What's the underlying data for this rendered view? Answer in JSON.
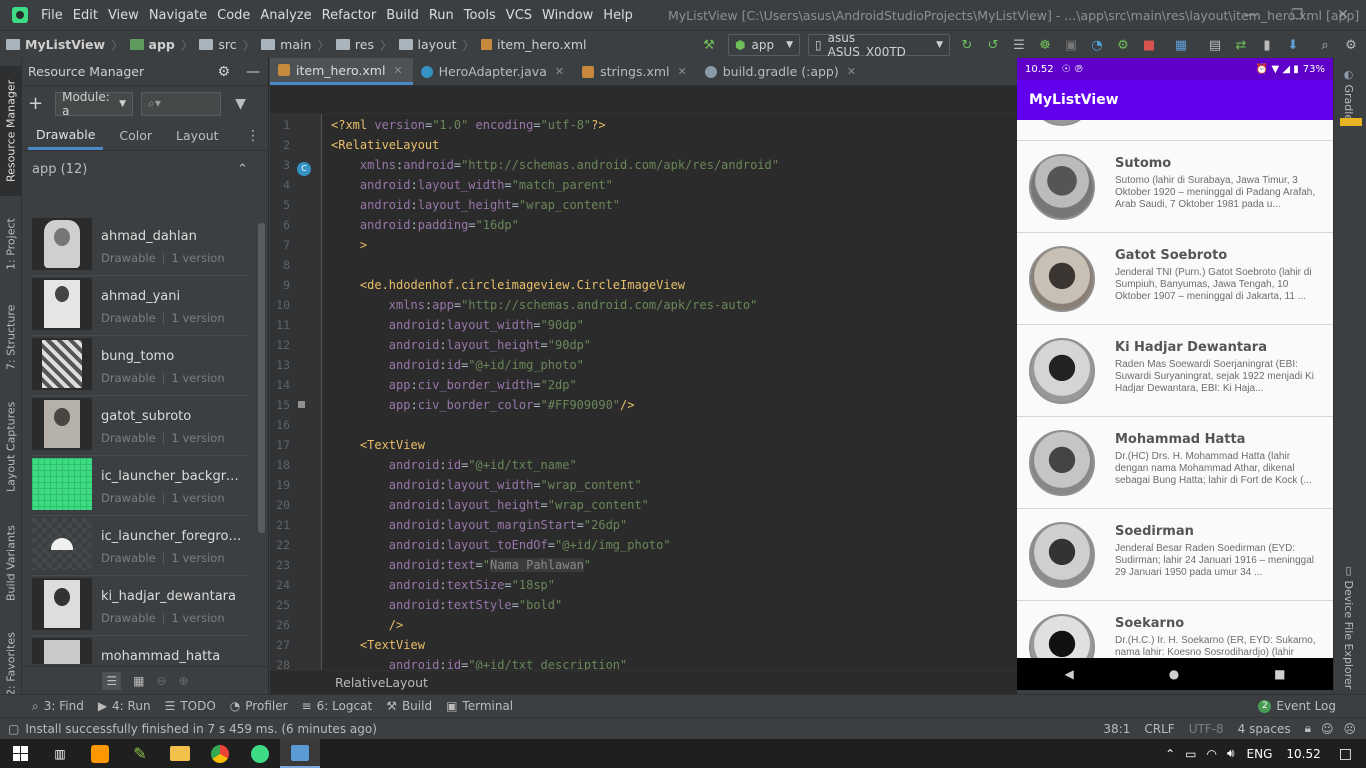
{
  "menu": [
    "File",
    "Edit",
    "View",
    "Navigate",
    "Code",
    "Analyze",
    "Refactor",
    "Build",
    "Run",
    "Tools",
    "VCS",
    "Window",
    "Help"
  ],
  "window_title": "MyListView [C:\\Users\\asus\\AndroidStudioProjects\\MyListView] - ...\\app\\src\\main\\res\\layout\\item_hero.xml [app]",
  "breadcrumbs": [
    "MyListView",
    "app",
    "src",
    "main",
    "res",
    "layout",
    "item_hero.xml"
  ],
  "run_config": "app",
  "device": "asus ASUS_X00TD",
  "resource_manager": {
    "title": "Resource Manager",
    "module_label": "Module: a",
    "tabs": [
      "Drawable",
      "Color",
      "Layout"
    ],
    "group_label": "app (12)",
    "items": [
      {
        "name": "ahmad_dahlan",
        "type": "Drawable",
        "versions": "1 version"
      },
      {
        "name": "ahmad_yani",
        "type": "Drawable",
        "versions": "1 version"
      },
      {
        "name": "bung_tomo",
        "type": "Drawable",
        "versions": "1 version"
      },
      {
        "name": "gatot_subroto",
        "type": "Drawable",
        "versions": "1 version"
      },
      {
        "name": "ic_launcher_backgrou...",
        "type": "Drawable",
        "versions": "1 version"
      },
      {
        "name": "ic_launcher_foregrou...",
        "type": "Drawable",
        "versions": "1 version"
      },
      {
        "name": "ki_hadjar_dewantara",
        "type": "Drawable",
        "versions": "1 version"
      },
      {
        "name": "mohammad_hatta",
        "type": "Drawable",
        "versions": "1 version"
      }
    ]
  },
  "left_tabs": [
    "Resource Manager",
    "1: Project",
    "7: Structure",
    "Layout Captures",
    "Build Variants",
    "2: Favorites"
  ],
  "editor_tabs": [
    {
      "label": "item_hero.xml",
      "active": true
    },
    {
      "label": "HeroAdapter.java",
      "active": false
    },
    {
      "label": "strings.xml",
      "active": false
    },
    {
      "label": "build.gradle (:app)",
      "active": false
    }
  ],
  "code_lines": [
    {
      "n": "1"
    },
    {
      "n": "2"
    },
    {
      "n": "3"
    },
    {
      "n": "4"
    },
    {
      "n": "5"
    },
    {
      "n": "6"
    },
    {
      "n": "7"
    },
    {
      "n": "8"
    },
    {
      "n": "9"
    },
    {
      "n": "10"
    },
    {
      "n": "11"
    },
    {
      "n": "12"
    },
    {
      "n": "13"
    },
    {
      "n": "14"
    },
    {
      "n": "15"
    },
    {
      "n": "16"
    },
    {
      "n": "17"
    },
    {
      "n": "18"
    },
    {
      "n": "19"
    },
    {
      "n": "20"
    },
    {
      "n": "21"
    },
    {
      "n": "22"
    },
    {
      "n": "23"
    },
    {
      "n": "24"
    },
    {
      "n": "25"
    },
    {
      "n": "26"
    },
    {
      "n": "27"
    },
    {
      "n": "28"
    }
  ],
  "editor_breadcrumb": "RelativeLayout",
  "phone": {
    "time": "10.52",
    "battery": "73%",
    "app_title": "MyListView",
    "heroes": [
      {
        "name": "Sutomo",
        "desc": "Sutomo (lahir di Surabaya, Jawa Timur, 3 Oktober 1920 – meninggal di Padang Arafah, Arab Saudi, 7 Oktober 1981 pada u..."
      },
      {
        "name": "Gatot Soebroto",
        "desc": "Jenderal TNI (Purn.) Gatot Soebroto (lahir di Sumpiuh, Banyumas, Jawa Tengah, 10 Oktober 1907 – meninggal di Jakarta, 11 ..."
      },
      {
        "name": "Ki Hadjar Dewantara",
        "desc": "Raden Mas Soewardi Soerjaningrat (EBI: Suwardi Suryaningrat, sejak 1922 menjadi Ki Hadjar Dewantara, EBI: Ki Haja..."
      },
      {
        "name": "Mohammad Hatta",
        "desc": "Dr.(HC) Drs. H. Mohammad Hatta (lahir dengan nama Mohammad Athar, dikenal sebagai Bung Hatta; lahir di Fort de Kock (..."
      },
      {
        "name": "Soedirman",
        "desc": "Jenderal Besar Raden Soedirman (EYD: Sudirman; lahir 24 Januari 1916 – meninggal 29 Januari 1950 pada umur 34 ..."
      },
      {
        "name": "Soekarno",
        "desc": "Dr.(H.C.) Ir. H. Soekarno (ER, EYD: Sukarno, nama lahir: Koesno Sosrodihardjo) (lahir"
      }
    ]
  },
  "right_tabs": [
    "Gradle",
    "Device File Explorer"
  ],
  "bottom_tools": [
    "3: Find",
    "4: Run",
    "TODO",
    "Profiler",
    "6: Logcat",
    "Build",
    "Terminal"
  ],
  "event_log": "Event Log",
  "event_count": "2",
  "status_message": "Install successfully finished in 7 s 459 ms. (6 minutes ago)",
  "status_right": {
    "pos": "38:1",
    "eol": "CRLF",
    "enc": "UTF-8",
    "indent": "4 spaces"
  },
  "taskbar": {
    "lang": "ENG",
    "time": "10.52"
  }
}
